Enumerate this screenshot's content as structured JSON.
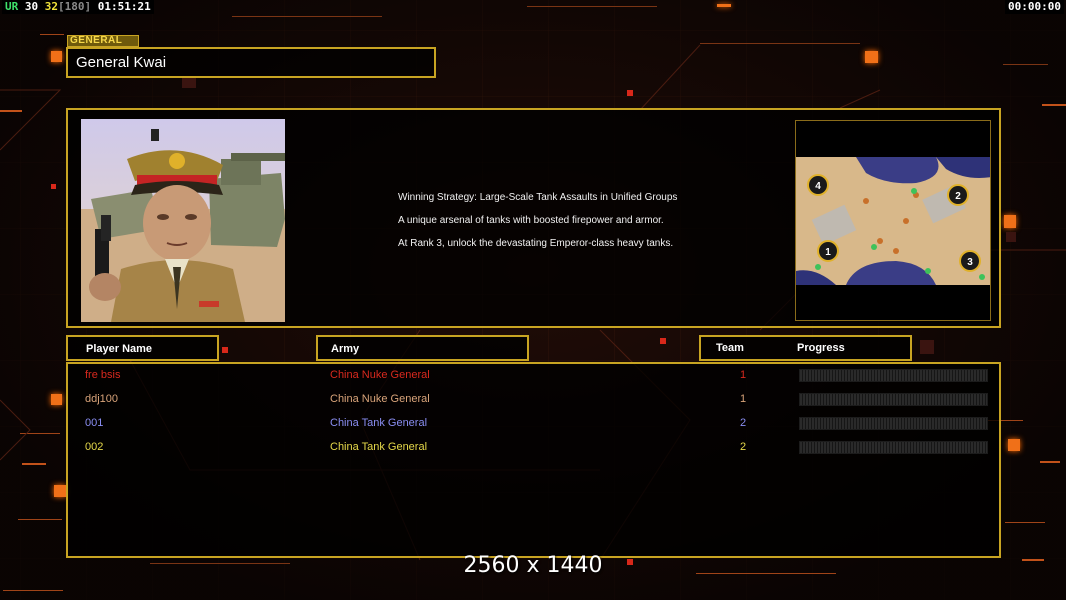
{
  "hud": {
    "ur_label": "UR",
    "val_a": "30",
    "val_b": "32",
    "val_c": "[180]",
    "clock": "01:51:21",
    "timer": "00:00:00"
  },
  "general": {
    "section_label": "GENERAL",
    "name": "General Kwai"
  },
  "description": [
    "Winning Strategy: Large-Scale Tank Assaults in Unified Groups",
    "A unique arsenal of tanks with boosted firepower and armor.",
    "At Rank 3, unlock the devastating Emperor-class heavy tanks."
  ],
  "minimap": {
    "start_positions": [
      "1",
      "2",
      "3",
      "4"
    ]
  },
  "table": {
    "headers": {
      "player_name": "Player Name",
      "army": "Army",
      "team": "Team",
      "progress": "Progress"
    },
    "rows": [
      {
        "name": "fre bsis",
        "army": "China Nuke General",
        "team": "1",
        "color": "#d8291e",
        "progress": 0
      },
      {
        "name": "ddj100",
        "army": "China Nuke General",
        "team": "1",
        "color": "#d9a47a",
        "progress": 0
      },
      {
        "name": "001",
        "army": "China Tank General",
        "team": "2",
        "color": "#8a8ef2",
        "progress": 0
      },
      {
        "name": "002",
        "army": "China Tank General",
        "team": "2",
        "color": "#e6d94a",
        "progress": 0
      }
    ]
  },
  "resolution": "2560 x 1440",
  "colors": {
    "frame": "#c8a422",
    "accent_orange": "#f07018",
    "background": "#120806"
  }
}
